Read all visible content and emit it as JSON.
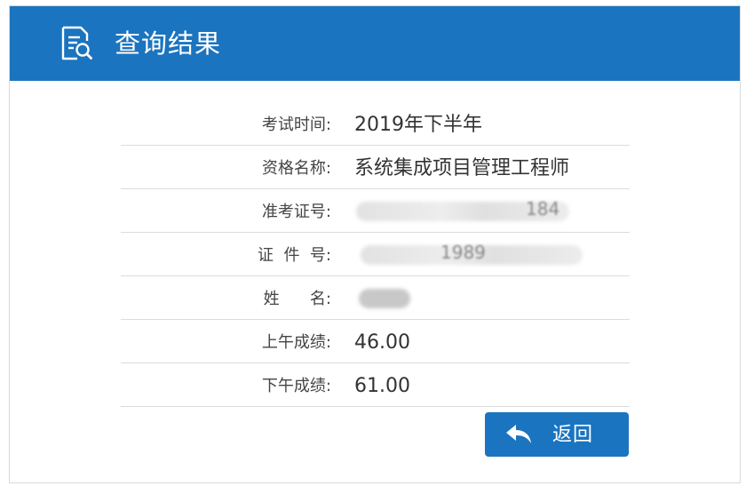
{
  "header": {
    "title": "查询结果",
    "icon": "search-document-icon"
  },
  "rows": [
    {
      "label": "考试时间:",
      "value": "2019年下半年"
    },
    {
      "label": "资格名称:",
      "value": "系统集成项目管理工程师"
    },
    {
      "label": "准考证号:",
      "value": "184"
    },
    {
      "label": "证  件  号:",
      "value": "1989"
    },
    {
      "label": "姓      名:",
      "value": ""
    },
    {
      "label": "上午成绩:",
      "value": "46.00"
    },
    {
      "label": "下午成绩:",
      "value": "61.00"
    }
  ],
  "actions": {
    "back_label": "返回",
    "back_icon": "reply-arrow-icon"
  },
  "colors": {
    "primary": "#1b74bf",
    "border": "#dcdcdc",
    "text": "#333333"
  }
}
